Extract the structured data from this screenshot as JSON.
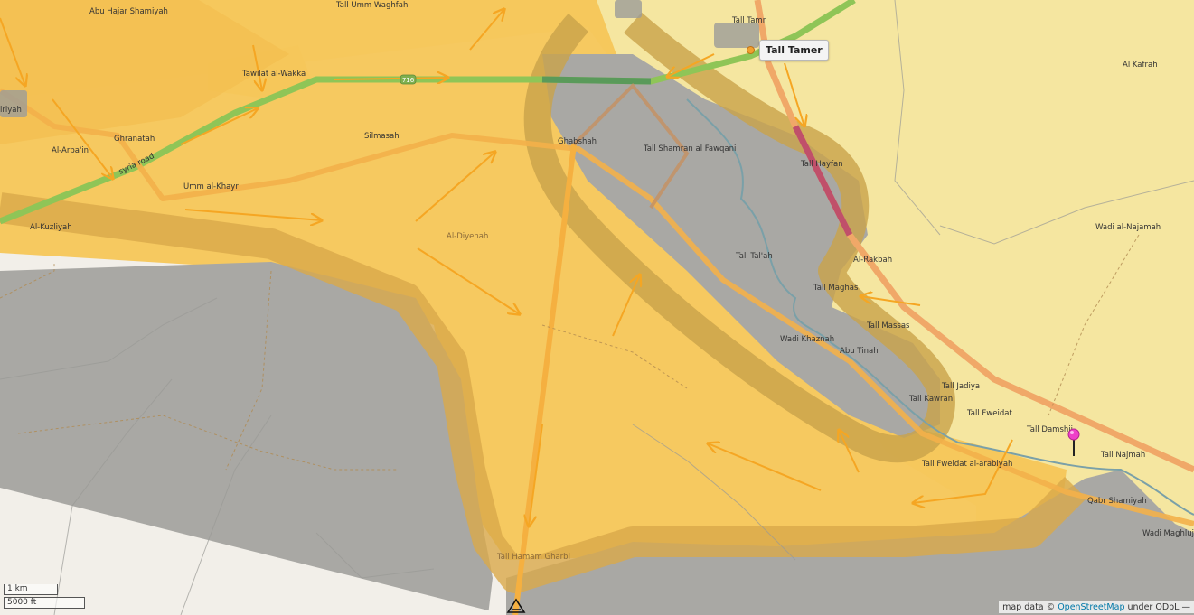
{
  "map": {
    "popup_label": "Tall Tamer",
    "road_label": "syria road",
    "road_shield": "716",
    "scale": {
      "metric": "1 km",
      "imperial": "5000 ft"
    },
    "attribution": {
      "prefix": "map data ©",
      "link_text": "OpenStreetMap",
      "suffix": "under ODbL —"
    },
    "colors": {
      "government_yellow": "#f5e6a0",
      "control_orange": "#f6c659",
      "contested_gray": "#a9a8a4",
      "frontline_band": "#d9a94a",
      "advance_arrows": "#f5a623",
      "highway": "#8fc557",
      "trunk_road": "#f0a868"
    },
    "places": {
      "abu_hajar": "Abu Hajar Shamiyah",
      "umm_waghfah": "Tall Umm Waghfah",
      "tall_tamr": "Tall Tamr",
      "tawilat": "Tawilat al-Wakka",
      "irlyah": "irlyah",
      "ghranatah": "Ghranatah",
      "arbain": "Al-Arba'in",
      "silmasah": "Silmasah",
      "ghabshah": "Ghabshah",
      "shamran": "Tall Shamran al Fawqani",
      "hayfan": "Tall Hayfan",
      "umm_khayr": "Umm al-Khayr",
      "kuzliyah": "Al-Kuzliyah",
      "diyenah": "Al-Diyenah",
      "kafrah": "Al Kafrah",
      "najamah": "Wadi al-Najamah",
      "tafah": "Tall Tal'ah",
      "rakbah": "Al-Rakbah",
      "maghas": "Tall Maghas",
      "massas": "Tall Massas",
      "khaznah": "Wadi Khaznah",
      "abu_tinah": "Abu Tinah",
      "jadiya": "Tall Jadiya",
      "kawran": "Tall Kawran",
      "fweidat": "Tall Fweidat",
      "damshij": "Tall Damshij",
      "najmah": "Tall Najmah",
      "fweidat_arabiyah": "Tall Fweidat al-arabiyah",
      "qabr": "Qabr Shamiyah",
      "maghlujah": "Wadi Maghlujah",
      "hamam": "Tall Hamam Gharbi"
    }
  }
}
